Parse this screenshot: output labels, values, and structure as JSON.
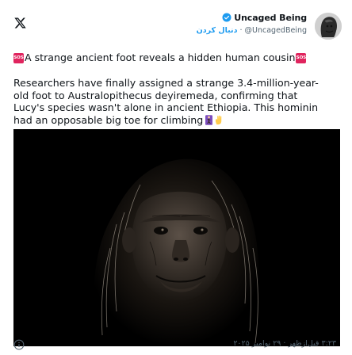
{
  "header": {
    "logo_icon": "x-logo-icon",
    "author": {
      "name": "Uncaged Being",
      "handle": "@UncagedBeing",
      "follow_label": "دنبال کردن",
      "separator": "·",
      "verified_icon": "verified-badge-icon",
      "verified_color": "#1d9bf0"
    }
  },
  "tweet": {
    "headline": "A strange ancient foot reveals a hidden human cousin",
    "headline_emoji": "sos-icon",
    "body_lines": [
      "Researchers have finally assigned a strange 3.4-million-year-",
      "old foot to Australopithecus deyiremeda, confirming that",
      "Lucy's species wasn't alone in ancient Ethiopia. This hominin",
      "had an opposable big toe for climbing"
    ],
    "body_emoji": [
      "climbing-icon",
      "hand-icon"
    ]
  },
  "media": {
    "description": "primate-portrait-image"
  },
  "footer": {
    "timestamp": "۳:۲۳ قبل‌ازظهر · ۲۹ نوامبر ۲۰۲۵",
    "info_icon": "info-icon"
  },
  "colors": {
    "text": "#0f1419",
    "secondary": "#536471",
    "link": "#1d9bf0",
    "sos": "#e0245e"
  }
}
